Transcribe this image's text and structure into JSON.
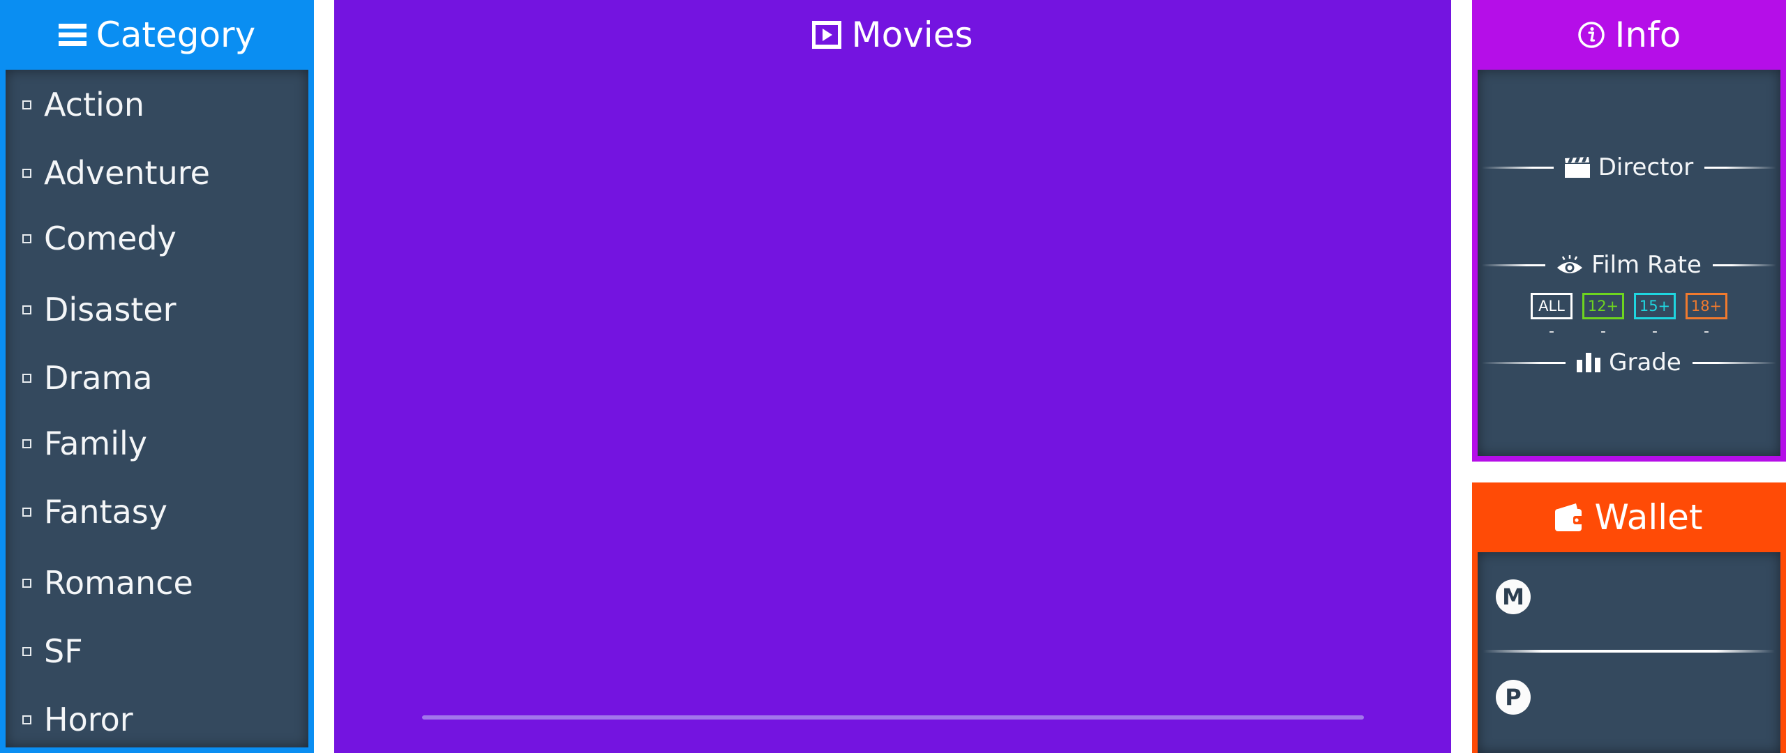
{
  "category": {
    "title": "Category",
    "icon": "menu-icon",
    "color": "#0a8ef2",
    "items": [
      {
        "label": "Action"
      },
      {
        "label": "Adventure"
      },
      {
        "label": "Comedy"
      },
      {
        "label": "Disaster"
      },
      {
        "label": "Drama"
      },
      {
        "label": "Family"
      },
      {
        "label": "Fantasy"
      },
      {
        "label": "Romance"
      },
      {
        "label": "SF"
      },
      {
        "label": "Horor"
      }
    ]
  },
  "movies": {
    "title": "Movies",
    "icon": "film-play-icon",
    "color": "#7414e0"
  },
  "info": {
    "title": "Info",
    "icon": "info-icon",
    "color": "#b50ee8",
    "director": {
      "label": "Director",
      "icon": "clapperboard-icon"
    },
    "film_rate": {
      "label": "Film Rate",
      "icon": "eye-icon",
      "rates": [
        {
          "label": "ALL",
          "count": "-",
          "color": "#ffffff"
        },
        {
          "label": "12+",
          "count": "-",
          "color": "#6ed51f"
        },
        {
          "label": "15+",
          "count": "-",
          "color": "#1fd6e0"
        },
        {
          "label": "18+",
          "count": "-",
          "color": "#f07a2e"
        }
      ]
    },
    "grade": {
      "label": "Grade",
      "icon": "bar-chart-icon"
    }
  },
  "wallet": {
    "title": "Wallet",
    "icon": "wallet-icon",
    "color": "#ff4b06",
    "coins": [
      {
        "symbol": "M",
        "icon": "m-coin-icon"
      },
      {
        "symbol": "P",
        "icon": "p-coin-icon"
      }
    ]
  }
}
